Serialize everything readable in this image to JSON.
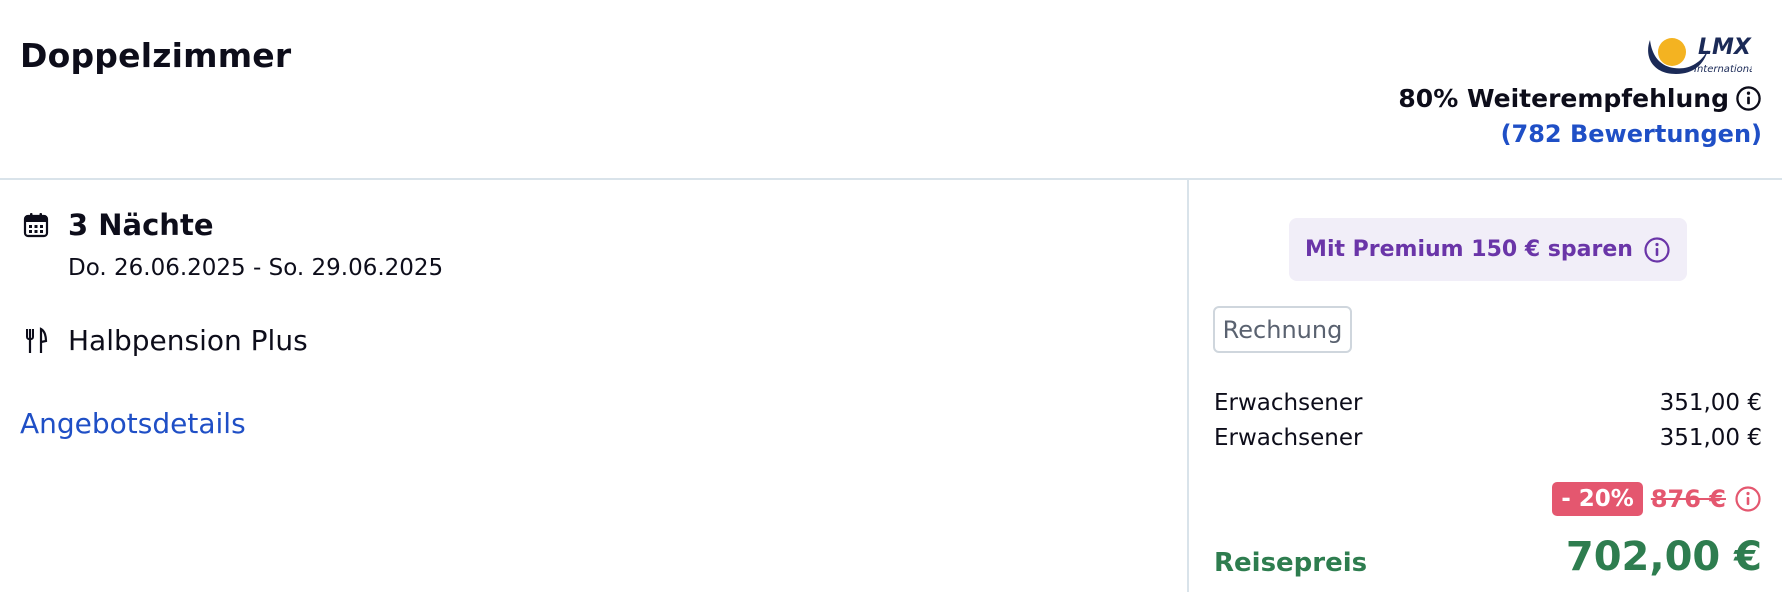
{
  "header": {
    "room_title": "Doppelzimmer",
    "logo_text": "LMX",
    "logo_subtext": "International",
    "recommendation": "80% Weiterempfehlung",
    "reviews": "(782 Bewertungen)"
  },
  "stay": {
    "nights": "3 Nächte",
    "dates": "Do. 26.06.2025 - So. 29.06.2025",
    "board": "Halbpension Plus",
    "offer_details_link": "Angebotsdetails"
  },
  "pricing": {
    "premium_banner": "Mit Premium 150 € sparen",
    "invoice_button": "Rechnung",
    "travellers": [
      {
        "label": "Erwachsener",
        "price": "351,00 €"
      },
      {
        "label": "Erwachsener",
        "price": "351,00 €"
      }
    ],
    "discount": "- 20%",
    "old_price": "876 €",
    "total_label": "Reisepreis",
    "total_price": "702,00 €"
  },
  "icons": {
    "calendar": "calendar-icon",
    "cutlery": "cutlery-icon",
    "info": "info-icon"
  },
  "colors": {
    "link_blue": "#1f4fc6",
    "premium_purple": "#6a35a8",
    "premium_bg": "#f1eef8",
    "discount_red": "#e4576f",
    "total_green": "#2e7d4f",
    "logo_yellow": "#f4b321",
    "logo_navy": "#1b2a57"
  }
}
